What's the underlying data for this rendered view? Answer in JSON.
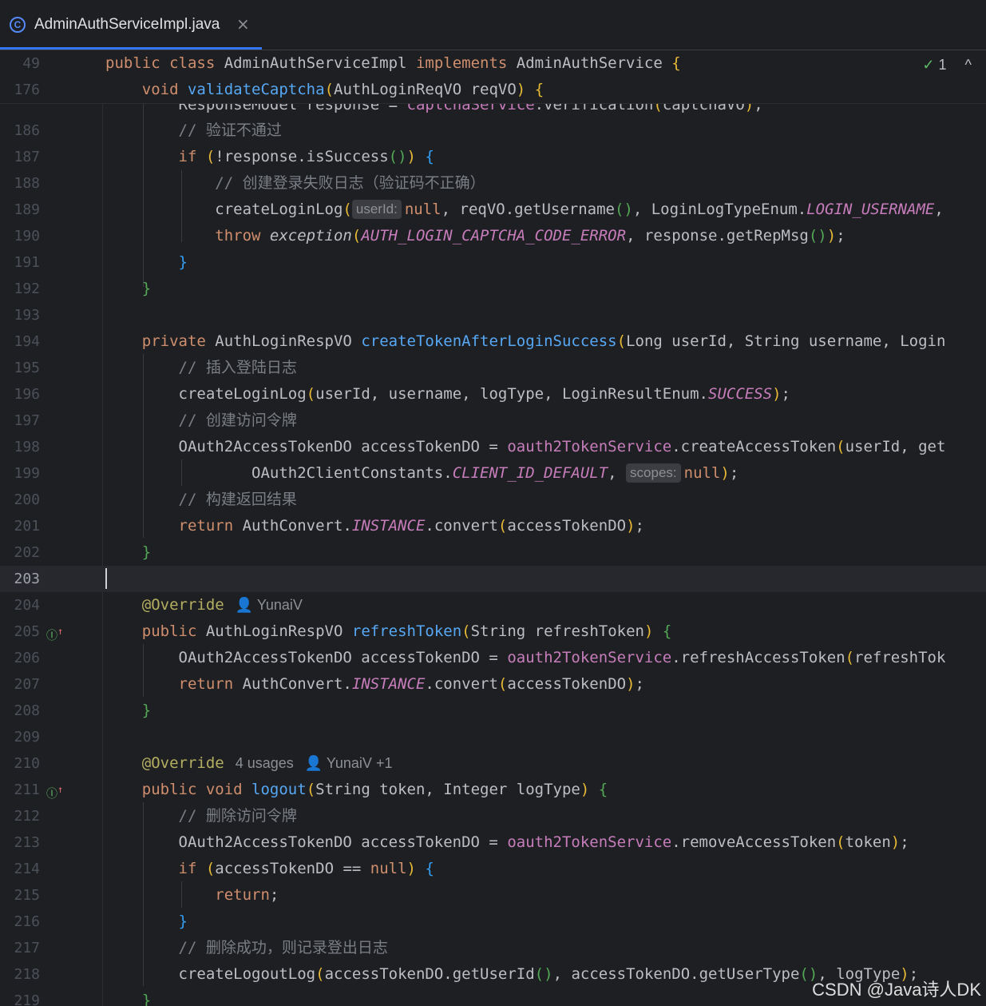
{
  "tab": {
    "icon": "class-icon",
    "title": "AdminAuthServiceImpl.java",
    "close": "×"
  },
  "status": {
    "check": "✓",
    "count": "1",
    "chevron": "^"
  },
  "sticky": [
    {
      "ln": "49",
      "text": "public class AdminAuthServiceImpl implements AdminAuthService {"
    },
    {
      "ln": "176",
      "text": "void validateCaptcha(AuthLoginReqVO reqVO) {"
    }
  ],
  "partial_line": {
    "text": "ResponseModel response = captchaService.verification(captchaVO);"
  },
  "lines": [
    {
      "ln": "186",
      "text": "// 验证不通过"
    },
    {
      "ln": "187",
      "text": "if (!response.isSuccess()) {"
    },
    {
      "ln": "188",
      "text": "// 创建登录失败日志（验证码不正确）"
    },
    {
      "ln": "189",
      "pre": "createLoginLog(",
      "hint": "userId:",
      "post": "null, reqVO.getUsername(), LoginLogTypeEnum.LOGIN_USERNAME,"
    },
    {
      "ln": "190",
      "text": "throw exception(AUTH_LOGIN_CAPTCHA_CODE_ERROR, response.getRepMsg());"
    },
    {
      "ln": "191",
      "text": "}"
    },
    {
      "ln": "192",
      "text": "}"
    },
    {
      "ln": "193",
      "text": ""
    },
    {
      "ln": "194",
      "text": "private AuthLoginRespVO createTokenAfterLoginSuccess(Long userId, String username, Login"
    },
    {
      "ln": "195",
      "text": "// 插入登陆日志"
    },
    {
      "ln": "196",
      "text": "createLoginLog(userId, username, logType, LoginResultEnum.SUCCESS);"
    },
    {
      "ln": "197",
      "text": "// 创建访问令牌"
    },
    {
      "ln": "198",
      "text": "OAuth2AccessTokenDO accessTokenDO = oauth2TokenService.createAccessToken(userId, get"
    },
    {
      "ln": "199",
      "pre": "OAuth2ClientConstants.CLIENT_ID_DEFAULT,",
      "hint": "scopes:",
      "post": "null);"
    },
    {
      "ln": "200",
      "text": "// 构建返回结果"
    },
    {
      "ln": "201",
      "text": "return AuthConvert.INSTANCE.convert(accessTokenDO);"
    },
    {
      "ln": "202",
      "text": "}"
    },
    {
      "ln": "203",
      "text": ""
    },
    {
      "ln": "204",
      "text": "@Override",
      "author": "YunaiV"
    },
    {
      "ln": "205",
      "text": "public AuthLoginRespVO refreshToken(String refreshToken) {"
    },
    {
      "ln": "206",
      "text": "OAuth2AccessTokenDO accessTokenDO = oauth2TokenService.refreshAccessToken(refreshTok"
    },
    {
      "ln": "207",
      "text": "return AuthConvert.INSTANCE.convert(accessTokenDO);"
    },
    {
      "ln": "208",
      "text": "}"
    },
    {
      "ln": "209",
      "text": ""
    },
    {
      "ln": "210",
      "text": "@Override",
      "usages": "4 usages",
      "author": "YunaiV +1"
    },
    {
      "ln": "211",
      "text": "public void logout(String token, Integer logType) {"
    },
    {
      "ln": "212",
      "text": "// 删除访问令牌"
    },
    {
      "ln": "213",
      "text": "OAuth2AccessTokenDO accessTokenDO = oauth2TokenService.removeAccessToken(token);"
    },
    {
      "ln": "214",
      "text": "if (accessTokenDO == null) {"
    },
    {
      "ln": "215",
      "text": "return;"
    },
    {
      "ln": "216",
      "text": "}"
    },
    {
      "ln": "217",
      "text": "// 删除成功，则记录登出日志"
    },
    {
      "ln": "218",
      "text": "createLogoutLog(accessTokenDO.getUserId(), accessTokenDO.getUserType(), logType);"
    },
    {
      "ln": "219",
      "text": "}"
    }
  ],
  "watermark": "CSDN @Java诗人DK",
  "colors": {
    "keyword": "#cf8e6d",
    "function": "#56a8f5",
    "field": "#c77dbb",
    "annotation": "#b3ae60",
    "comment": "#7a7e85",
    "background": "#1e1f22",
    "tab_accent": "#3574f0"
  }
}
